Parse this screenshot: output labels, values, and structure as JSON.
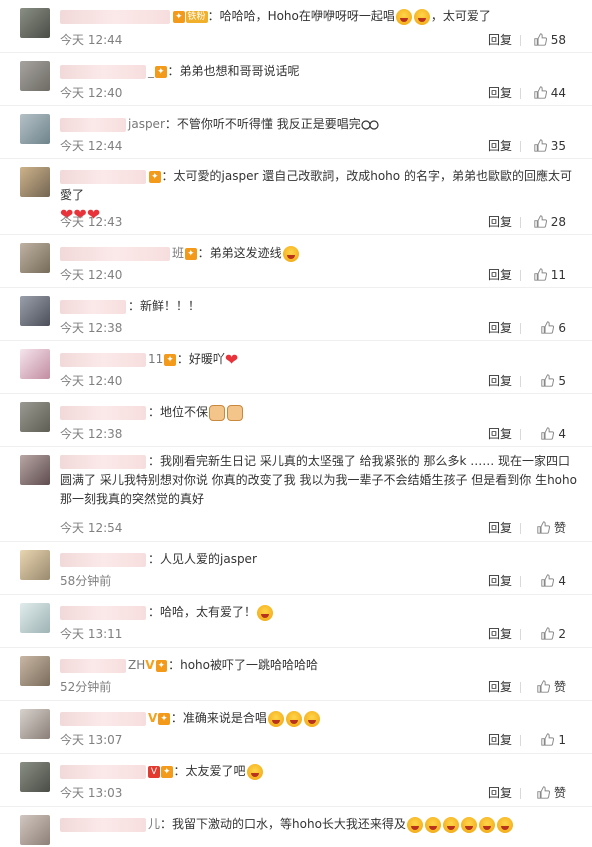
{
  "ui": {
    "reply_label": "回复",
    "like_empty_label": "赞"
  },
  "comments": [
    {
      "name_tail": "",
      "badges": [
        "vip",
        "fans"
      ],
      "fans_label": "铁粉",
      "text": "：哈哈哈，Hoho在咿咿呀呀一起唱",
      "extra": "，太可爱了",
      "time": "今天 12:44",
      "likes": "58"
    },
    {
      "name_tail": "_",
      "badges": [
        "vip"
      ],
      "text": "：弟弟也想和哥哥说话呢",
      "time": "今天 12:40",
      "likes": "44"
    },
    {
      "name_tail": "jasper",
      "badges": [],
      "text": "：不管你听不听得懂 我反正是要唱完",
      "time": "今天 12:44",
      "likes": "35"
    },
    {
      "name_tail": "",
      "badges": [
        "vip"
      ],
      "text": "：太可愛的jasper 還自己改歌詞，改成hoho 的名字，弟弟也歐歐的回應太可愛了",
      "time": "今天 12:43",
      "likes": "28"
    },
    {
      "name_tail": "班",
      "badges": [
        "vip"
      ],
      "text": "：弟弟这发迹线",
      "time": "今天 12:40",
      "likes": "11"
    },
    {
      "name_tail": "",
      "badges": [],
      "text": "：新鲜！！！",
      "time": "今天 12:38",
      "likes": "6"
    },
    {
      "name_tail": "11",
      "badges": [
        "vip"
      ],
      "text": "：好暖吖",
      "time": "今天 12:40",
      "likes": "5"
    },
    {
      "name_tail": "",
      "badges": [],
      "text": "：地位不保",
      "time": "今天 12:38",
      "likes": "4"
    },
    {
      "name_tail": "",
      "badges": [],
      "text": "：我刚看完新生日记 采儿真的太坚强了 给我紧张的 那么多k ……  现在一家四口圆满了 采儿我特别想对你说 你真的改变了我 我以为我一辈子不会结婚生孩子 但是看到你 生hoho 那一刻我真的突然觉的真好",
      "time": "今天 12:54",
      "likes": ""
    },
    {
      "name_tail": "",
      "badges": [],
      "text": "：人见人爱的jasper",
      "time": "58分钟前",
      "likes": "4"
    },
    {
      "name_tail": "",
      "badges": [],
      "text": "：哈哈，太有爱了！",
      "time": "今天 13:11",
      "likes": "2"
    },
    {
      "name_tail": "ZH",
      "badges": [
        "v",
        "vip"
      ],
      "text": "：hoho被吓了一跳哈哈哈哈",
      "time": "52分钟前",
      "likes": ""
    },
    {
      "name_tail": "",
      "badges": [
        "v",
        "vip"
      ],
      "text": "：准确来说是合唱",
      "time": "今天 13:07",
      "likes": "1"
    },
    {
      "name_tail": "",
      "badges": [
        "vbox",
        "vip"
      ],
      "text": "：太友爱了吧",
      "time": "今天 13:03",
      "likes": ""
    },
    {
      "name_tail": "儿",
      "badges": [],
      "text": "：我留下激动的口水，等hoho长大我还来得及",
      "time": "",
      "likes": ""
    }
  ]
}
